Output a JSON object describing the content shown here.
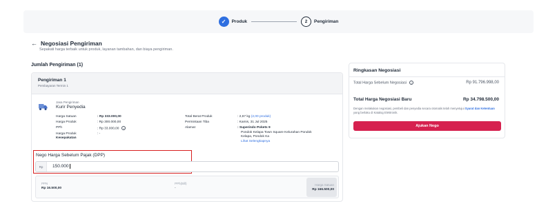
{
  "stepper": {
    "step1_label": "Produk",
    "step2_number": "2",
    "step2_label": "Pengiriman"
  },
  "header": {
    "title": "Negosiasi Pengiriman",
    "subtitle": "Sepakati harga terbaik untuk produk, layanan tambahan, dan biaya pengiriman."
  },
  "section": {
    "title": "Jumlah Pengiriman (1)"
  },
  "shipment": {
    "title": "Pengiriman 1",
    "term": "Pembayaran Termin 1",
    "courier_label": "Jasa Pengiriman",
    "courier_value": "Kurir Penyedia",
    "left_fields": [
      {
        "label": "Harga Satuan",
        "value": ": Rp 333.000,00"
      },
      {
        "label": "Harga Produk",
        "value": ": Rp 300.000,00"
      },
      {
        "label": "PPh",
        "value": ": Rp 33.000,00"
      },
      {
        "label": "Harga Produk",
        "value": ": -"
      }
    ],
    "left_extra_label": "Kesepakatan",
    "right_fields": [
      {
        "label": "Total Berat Produk",
        "value": ": 2,67 kg"
      },
      {
        "label": "Permintaan Tiba",
        "value": ": Kamis, 31 Jul 2025"
      },
      {
        "label": "Alamat",
        "value": ": Superindo Pokets 9"
      }
    ],
    "weight_link": "(2,00 produk)",
    "address_line2": "Pondok Kelapa Town Square Kelurahan Pondok",
    "address_line3": "Kelapa, Pondok Ka",
    "address_more": "Lihat Selengkapnya"
  },
  "nego": {
    "label": "Nego Harga Sebelum Pajak (DPP)",
    "prefix": "Rp",
    "value": "150.000"
  },
  "breakdown": {
    "ppn_label": "PPN",
    "ppn_value": "Rp 16.500,00",
    "pph_label": "PPh(Bill)",
    "pph_value": "-",
    "unit_label": "Harga Satuan",
    "unit_value": "Rp 166.500,00"
  },
  "summary": {
    "title": "Ringkasan Negosiasi",
    "before_label": "Total Harga Sebelum Negosiasi",
    "before_value": "Rp 91.796.998,00",
    "total_label": "Total Harga Negosiasi Baru",
    "total_value": "Rp 34.798.500,00",
    "note_pre": "Dengan melakukan negosiasi, pembeli dan penyedia secara otomatis telah menyetujui",
    "note_link": "Syarat dan Ketentuan",
    "note_post": "yang berlaku di Katalog Elektronik.",
    "button": "Ajukan Nego"
  },
  "colors": {
    "primary": "#2f6fe0",
    "accent": "#d6214f",
    "highlight_border": "#d71d1d"
  }
}
